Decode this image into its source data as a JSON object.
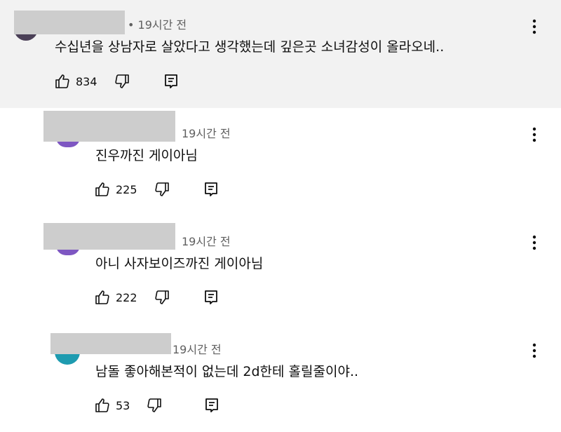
{
  "comments": [
    {
      "time": "• 19시간 전",
      "text": "수십년을 상남자로 살았다고 생각했는데 깊은곳 소녀감성이 올라오네..",
      "likes": "834",
      "avatar_color": "#4a3f56"
    },
    {
      "time": "19시간 전",
      "text": "진우까진 게이아님",
      "likes": "225",
      "avatar_color": "#7e57c2"
    },
    {
      "time": "19시간 전",
      "text": "아니 사자보이즈까진 게이아님",
      "likes": "222",
      "avatar_color": "#7e57c2"
    },
    {
      "time": "19시간 전",
      "text": "남돌 좋아해본적이 없는데 2d한테 홀릴줄이야..",
      "likes": "53",
      "avatar_color": "#1e9bb0"
    }
  ],
  "icons": {
    "like": "thumbs-up-icon",
    "dislike": "thumbs-down-icon",
    "reply": "reply-icon",
    "more": "more-vertical-icon"
  },
  "colors": {
    "highlight_background": "#f2f2f2",
    "redaction": "#cdcdcd",
    "meta_text": "#606060"
  }
}
